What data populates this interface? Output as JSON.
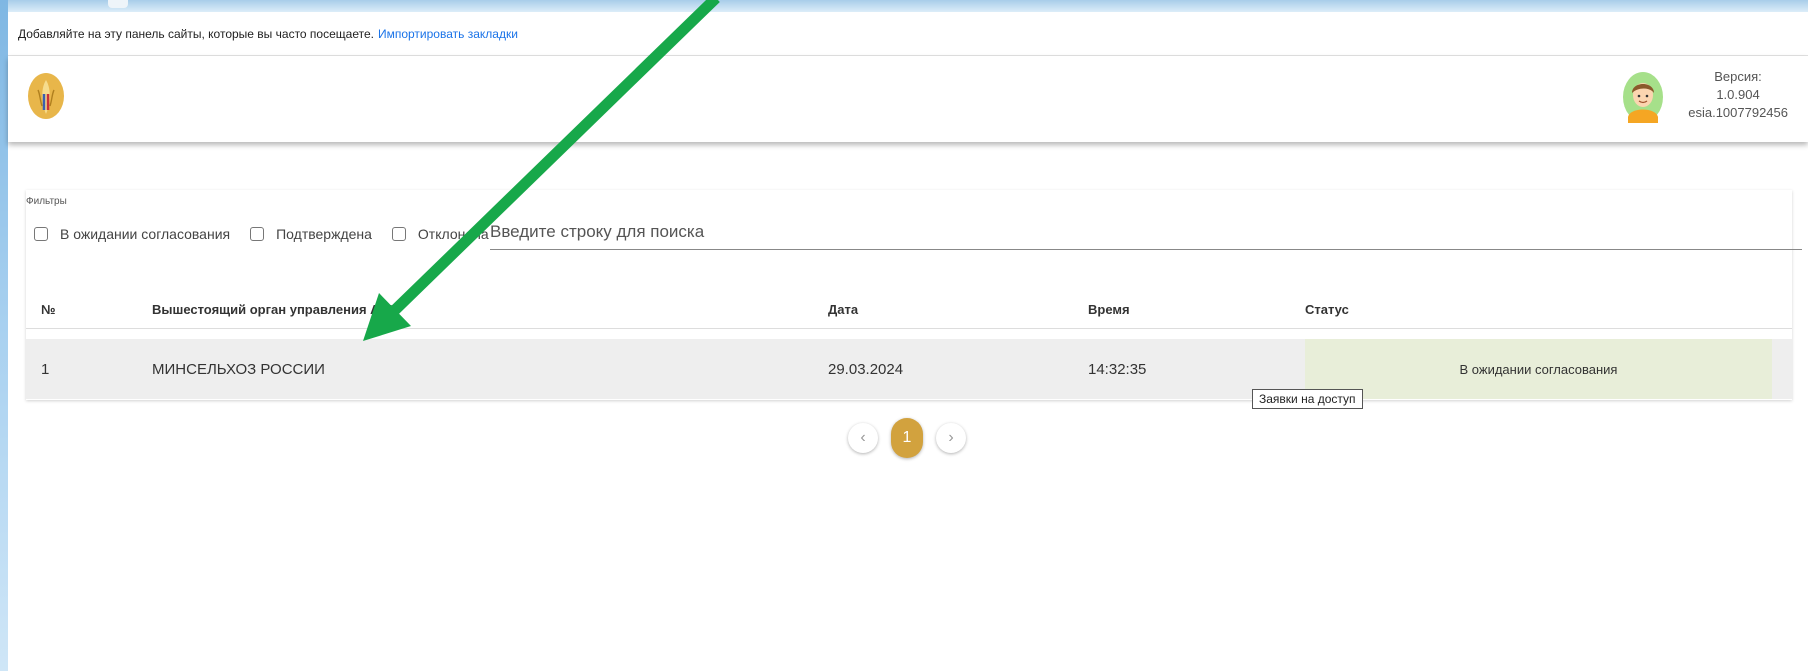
{
  "bookmarks_bar": {
    "text": "Добавляйте на эту панель сайты, которые вы часто посещаете.",
    "import_link": "Импортировать закладки"
  },
  "header": {
    "version_label": "Версия:",
    "version_number": "1.0.904",
    "esia_id": "esia.1007792456",
    "logo_icon": "wheat-emblem-icon",
    "avatar_icon": "user-avatar-icon"
  },
  "filters": {
    "title": "Фильтры",
    "checkboxes": [
      {
        "label": "В ожидании согласования",
        "checked": false
      },
      {
        "label": "Подтверждена",
        "checked": false
      },
      {
        "label": "Отклонена",
        "checked": false
      }
    ],
    "search_placeholder": "Введите строку для поиска"
  },
  "table": {
    "columns": [
      "№",
      "Вышестоящий орган управления АПК",
      "Дата",
      "Время",
      "Статус"
    ],
    "rows": [
      {
        "num": "1",
        "org": "МИНСЕЛЬХОЗ РОССИИ",
        "date": "29.03.2024",
        "time": "14:32:35",
        "status": "В ожидании согласования"
      }
    ]
  },
  "tooltip": "Заявки на доступ",
  "pagination": {
    "current_page": "1",
    "prev_icon": "chevron-left-icon",
    "next_icon": "chevron-right-icon"
  },
  "colors": {
    "accent": "#d2a23e",
    "status_pending_bg": "#e8eed9",
    "annotation_arrow": "#17a84a",
    "link": "#1a73e8"
  }
}
